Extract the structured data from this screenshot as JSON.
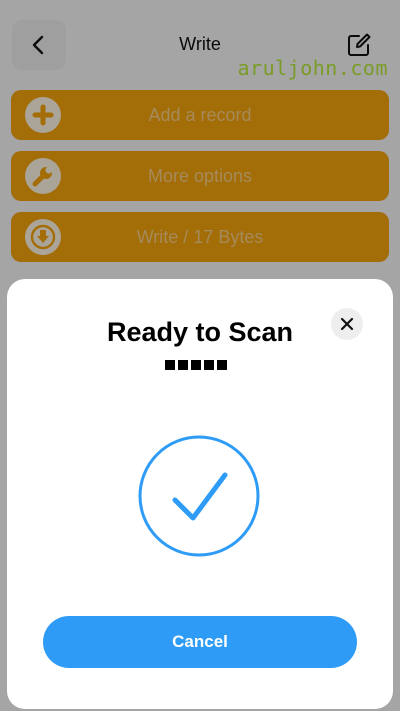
{
  "header": {
    "title": "Write",
    "back_icon": "chevron-left-icon",
    "edit_icon": "edit-note-icon"
  },
  "watermark": "aruljohn.com",
  "actions": [
    {
      "label": "Add a record",
      "icon": "plus-circle-icon"
    },
    {
      "label": "More options",
      "icon": "wrench-icon"
    },
    {
      "label": "Write / 17 Bytes",
      "icon": "download-circle-icon"
    }
  ],
  "sheet": {
    "title": "Ready to Scan",
    "close_icon": "close-icon",
    "status_icon": "checkmark-circle-icon",
    "cancel_label": "Cancel"
  },
  "colors": {
    "action_bg": "#f3a30b",
    "accent_blue": "#2e9cf7",
    "watermark": "#b6e83a"
  }
}
